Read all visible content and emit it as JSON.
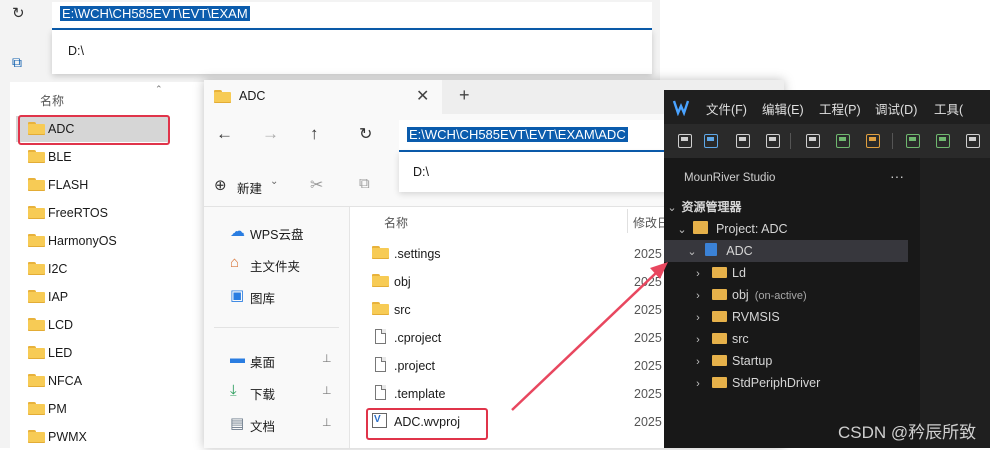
{
  "back_explorer": {
    "address_value": "E:\\WCH\\CH585EVT\\EVT\\EXAM",
    "suggestion": "D:\\",
    "column_name": "名称",
    "folders": [
      "ADC",
      "BLE",
      "FLASH",
      "FreeRTOS",
      "HarmonyOS",
      "I2C",
      "IAP",
      "LCD",
      "LED",
      "NFCA",
      "PM",
      "PWMX"
    ]
  },
  "front_explorer": {
    "tab_title": "ADC",
    "address_value": "E:\\WCH\\CH585EVT\\EVT\\EXAM\\ADC",
    "suggestion": "D:\\",
    "new_label": "新建",
    "col_name": "名称",
    "col_modified": "修改日",
    "nav": [
      "WPS云盘",
      "主文件夹",
      "图库",
      "桌面",
      "下载",
      "文档"
    ],
    "files": [
      {
        "name": ".settings",
        "date": "2025"
      },
      {
        "name": "obj",
        "date": "2025"
      },
      {
        "name": "src",
        "date": "2025"
      },
      {
        "name": ".cproject",
        "date": "2025"
      },
      {
        "name": ".project",
        "date": "2025"
      },
      {
        "name": ".template",
        "date": "2025"
      },
      {
        "name": "ADC.wvproj",
        "date": "2025"
      }
    ]
  },
  "mounriver": {
    "menu": [
      "文件(F)",
      "编辑(E)",
      "工程(P)",
      "调试(D)",
      "工具("
    ],
    "panel_title": "MounRiver Studio",
    "panel_more": "···",
    "section": "资源管理器",
    "project": "Project: ADC",
    "root": "ADC",
    "children": [
      {
        "name": "Ld",
        "extra": ""
      },
      {
        "name": "obj",
        "extra": "(on-active)"
      },
      {
        "name": "RVMSIS",
        "extra": ""
      },
      {
        "name": "src",
        "extra": ""
      },
      {
        "name": "Startup",
        "extra": ""
      },
      {
        "name": "StdPeriphDriver",
        "extra": ""
      }
    ]
  },
  "watermark": "CSDN @矜辰所致",
  "colors": {
    "highlight_box": "#e0344a",
    "arrow": "#e8475f",
    "selection": "#0b5cad"
  }
}
